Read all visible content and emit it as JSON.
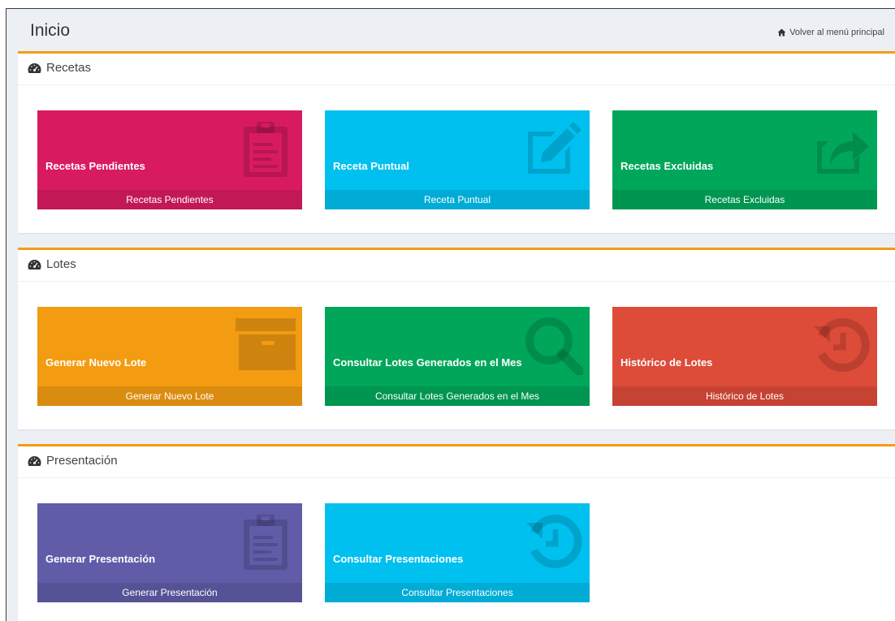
{
  "header": {
    "title": "Inicio",
    "back_link": "Volver al menú principal",
    "back_icon": "home-icon"
  },
  "sections": [
    {
      "title": "Recetas",
      "icon": "dashboard-icon",
      "tiles": [
        {
          "title": "Recetas Pendientes",
          "footer": "Recetas Pendientes",
          "color": "#d81b60",
          "icon": "clipboard-icon"
        },
        {
          "title": "Receta Puntual",
          "footer": "Receta Puntual",
          "color": "#00c0ef",
          "icon": "edit-icon"
        },
        {
          "title": "Recetas Excluidas",
          "footer": "Recetas Excluidas",
          "color": "#00a65a",
          "icon": "share-icon"
        }
      ]
    },
    {
      "title": "Lotes",
      "icon": "dashboard-icon",
      "tiles": [
        {
          "title": "Generar Nuevo Lote",
          "footer": "Generar Nuevo Lote",
          "color": "#f39c12",
          "icon": "archive-icon"
        },
        {
          "title": "Consultar Lotes Generados en el Mes",
          "footer": "Consultar Lotes Generados en el Mes",
          "color": "#00a65a",
          "icon": "search-icon"
        },
        {
          "title": "Histórico de Lotes",
          "footer": "Histórico de Lotes",
          "color": "#dd4b39",
          "icon": "history-icon"
        }
      ]
    },
    {
      "title": "Presentación",
      "icon": "dashboard-icon",
      "tiles": [
        {
          "title": "Generar Presentación",
          "footer": "Generar Presentación",
          "color": "#605ca8",
          "icon": "clipboard-icon"
        },
        {
          "title": "Consultar Presentaciones",
          "footer": "Consultar Presentaciones",
          "color": "#00c0ef",
          "icon": "history-icon"
        }
      ]
    }
  ]
}
